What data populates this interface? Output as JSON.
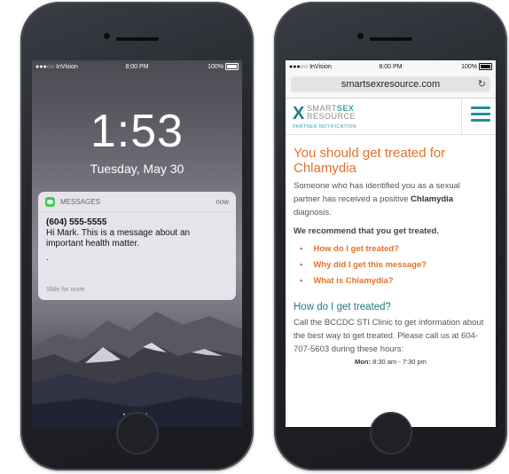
{
  "lock": {
    "status": {
      "carrier": "●●●○○ InVision",
      "time": "8:00 PM",
      "battery": "100%"
    },
    "clock": "1:53",
    "date": "Tuesday, May 30",
    "notification": {
      "app": "MESSAGES",
      "when": "now",
      "sender": "(604) 555-5555",
      "message": "Hi Mark. This is a message about an important health matter.",
      "dot": ".",
      "slide": "Slide for more"
    },
    "pager": "• • ◘"
  },
  "browser": {
    "status": {
      "carrier": "●●●○○ InVision",
      "time": "8:00 PM",
      "battery": "100%"
    },
    "url": "smartsexresource.com",
    "logo": {
      "word1a": "SMART",
      "word1b": "SEX",
      "word2": "RESOURCE",
      "sub": "PARTNER NOTIFICATION"
    },
    "headline": "You should get treated for Chlamydia",
    "intro_pre": "Someone who has identified you as a sexual partner has received a positive ",
    "intro_bold": "Chlamydia",
    "intro_post": " diagnosis.",
    "recommend": "We recommend that you get treated.",
    "links": [
      "How do I get treated?",
      "Why did I get this message?",
      "What is Chlamydia?"
    ],
    "section_title": "How do I get treated?",
    "section_body": "Call the BCCDC STI Clinic to get information about the best way to get treated. Please call us at 604-707-5603 during these hours:",
    "hours_day": "Mon:",
    "hours_time": "8:30 am - 7:30 pm"
  },
  "colors": {
    "accent": "#e4702a",
    "teal": "#1f7a84",
    "message_green": "#3fca53"
  }
}
